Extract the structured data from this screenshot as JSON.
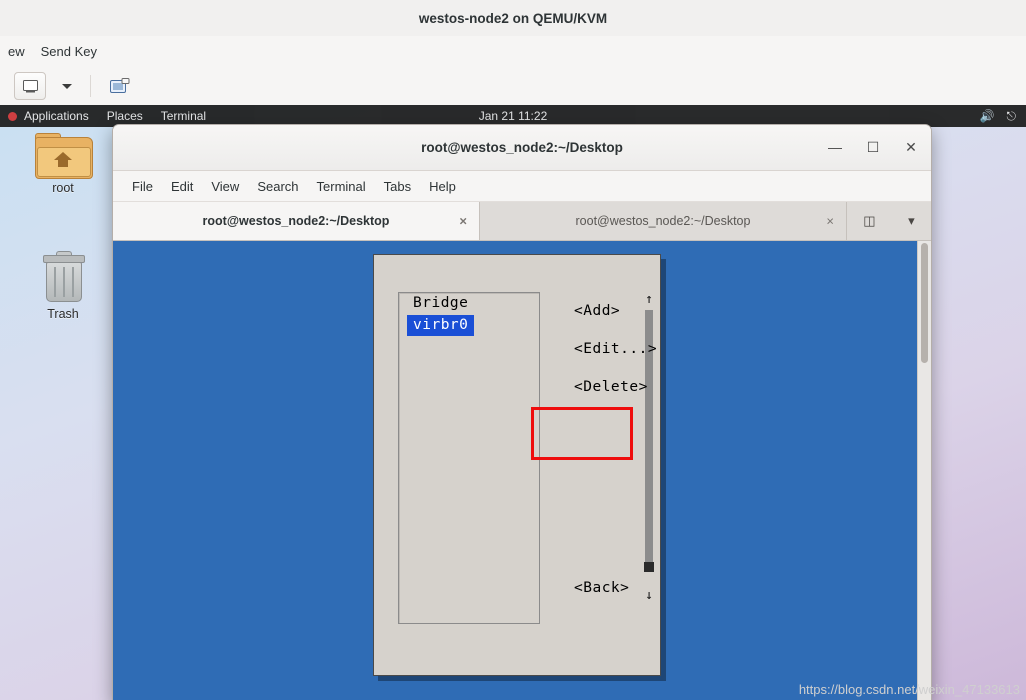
{
  "vm_window": {
    "title": "westos-node2 on QEMU/KVM",
    "menus": [
      "ew",
      "Send Key"
    ],
    "toolbar": {
      "console_icon": "monitor-icon",
      "dropdown_icon": "chevron-down-icon",
      "snapshot_icon": "snapshot-icon"
    }
  },
  "guest_desktop": {
    "topbar": {
      "activities_label": "Applications",
      "places_label": "Places",
      "app_label": "Terminal",
      "clock": "Jan 21  11:22",
      "volume_icon": "speaker-icon",
      "power_icon": "power-icon"
    },
    "icons": [
      {
        "name": "root",
        "label": "root",
        "glyph": "home-folder-icon"
      },
      {
        "name": "trash",
        "label": "Trash",
        "glyph": "trash-icon"
      }
    ]
  },
  "terminal": {
    "title": "root@westos_node2:~/Desktop",
    "window_controls": {
      "minimize": "—",
      "maximize": "☐",
      "close": "✕"
    },
    "menubar": [
      "File",
      "Edit",
      "View",
      "Search",
      "Terminal",
      "Tabs",
      "Help"
    ],
    "tabs": [
      {
        "label": "root@westos_node2:~/Desktop",
        "active": true,
        "close": "×"
      },
      {
        "label": "root@westos_node2:~/Desktop",
        "active": false,
        "close": "×"
      }
    ],
    "tabs_right": {
      "new_tab_icon": "new-tab-icon",
      "tab_menu_icon": "chevron-down-icon"
    }
  },
  "nmtui_dialog": {
    "list_header": "Bridge",
    "list_items": [
      {
        "label": "virbr0",
        "selected": true
      }
    ],
    "scroll_up_glyph": "↑",
    "scroll_down_glyph": "↓",
    "buttons": [
      {
        "label": "<Add>",
        "highlighted": true
      },
      {
        "label": "<Edit...>",
        "highlighted": false
      },
      {
        "label": "<Delete>",
        "highlighted": false
      }
    ],
    "back_button": "<Back>",
    "annotation_color": "#ef0d0d"
  },
  "watermark": "https://blog.csdn.net/weixin_47133613"
}
